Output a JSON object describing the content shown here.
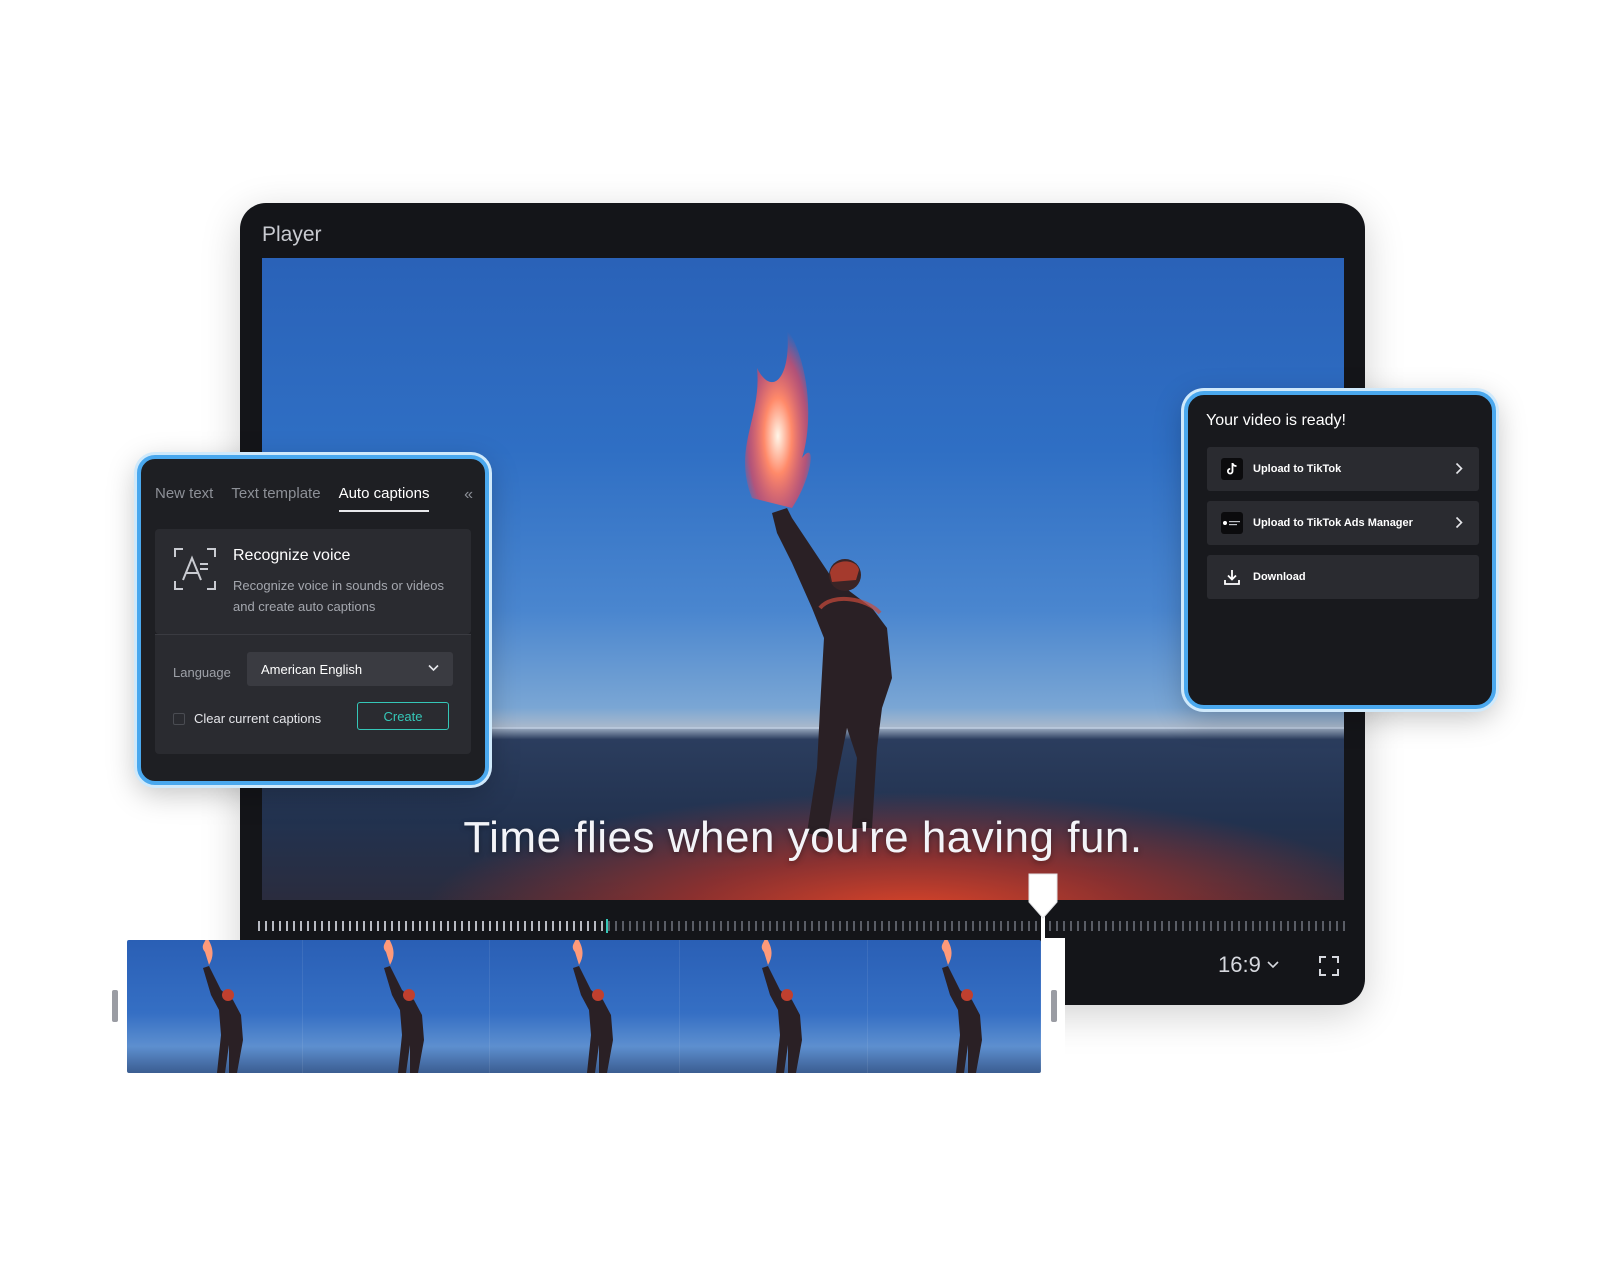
{
  "player": {
    "title": "Player",
    "caption": "Time flies when you're having fun.",
    "aspect_ratio": "16:9",
    "playback_progress": 0.72
  },
  "captions_panel": {
    "tabs": [
      {
        "label": "New text",
        "active": false
      },
      {
        "label": "Text template",
        "active": false
      },
      {
        "label": "Auto captions",
        "active": true
      }
    ],
    "recognize": {
      "title": "Recognize voice",
      "description": "Recognize voice in sounds or videos and create auto captions"
    },
    "language_label": "Language",
    "language_value": "American English",
    "clear_label": "Clear current captions",
    "clear_checked": false,
    "create_label": "Create"
  },
  "export_panel": {
    "title": "Your video is ready!",
    "items": [
      {
        "label": "Upload to TikTok",
        "icon": "tiktok-icon"
      },
      {
        "label": "Upload to TikTok Ads Manager",
        "icon": "tiktok-ads-icon"
      },
      {
        "label": "Download",
        "icon": "download-icon"
      }
    ]
  },
  "colors": {
    "accent": "#35c7b8",
    "highlight_border": "#4aa8ee",
    "panel_bg": "#1e1f23"
  }
}
